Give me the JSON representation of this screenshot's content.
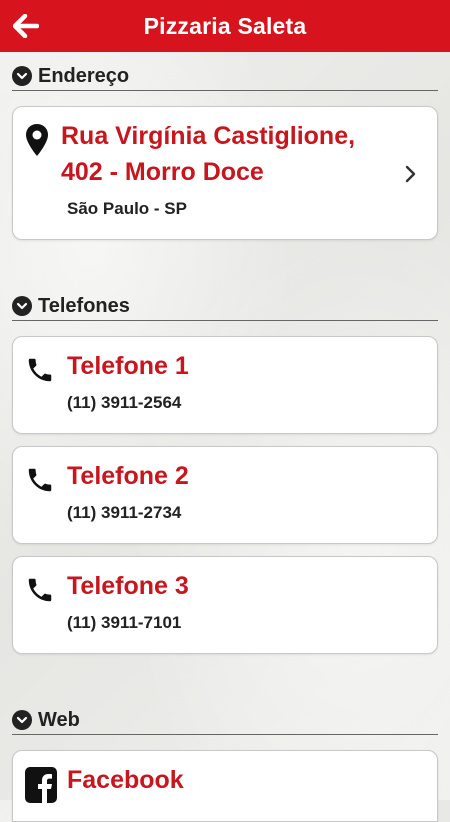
{
  "header": {
    "title": "Pizzaria Saleta"
  },
  "colors": {
    "brand": "#d7141d",
    "accent_text": "#c8161e"
  },
  "sections": {
    "address": {
      "label": "Endereço",
      "street_line1": "Rua Virgínia Castiglione,",
      "street_line2": "402 - Morro Doce",
      "city": "São Paulo - SP"
    },
    "phones": {
      "label": "Telefones",
      "items": [
        {
          "title": "Telefone 1",
          "number": "(11) 3911-2564"
        },
        {
          "title": "Telefone 2",
          "number": "(11) 3911-2734"
        },
        {
          "title": "Telefone 3",
          "number": "(11) 3911-7101"
        }
      ]
    },
    "web": {
      "label": "Web",
      "items": [
        {
          "title": "Facebook"
        }
      ]
    }
  },
  "icons": {
    "back": "arrow-left-icon",
    "section": "chevron-down-circle-icon",
    "map": "map-pin-icon",
    "phone": "phone-icon",
    "facebook": "facebook-icon",
    "more": "chevron-right-icon"
  }
}
